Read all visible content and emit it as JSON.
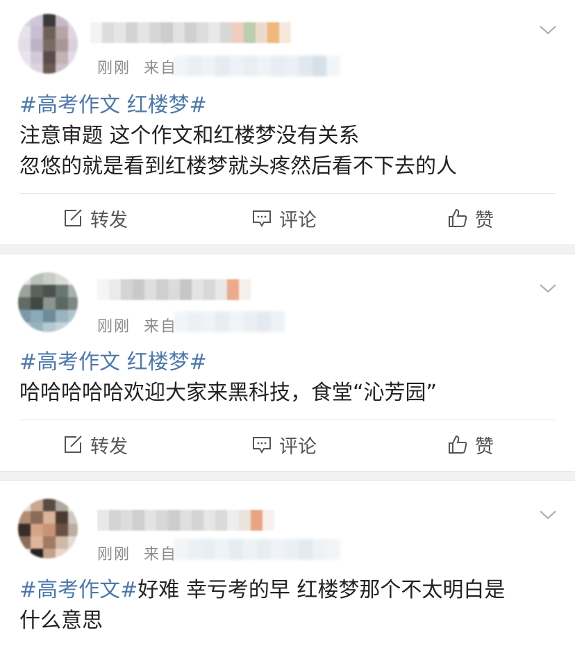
{
  "posts": [
    {
      "meta_time": "刚刚",
      "meta_from": "来自",
      "tag": "#高考作文 红楼梦#",
      "lines": [
        "注意审题 这个作文和红楼梦没有关系",
        "忽悠的就是看到红楼梦就头疼然后看不下去的人"
      ],
      "actions": {
        "repost": "转发",
        "comment": "评论",
        "like": "赞"
      }
    },
    {
      "meta_time": "刚刚",
      "meta_from": "来自",
      "tag": "#高考作文 红楼梦#",
      "lines": [
        "哈哈哈哈哈欢迎大家来黑科技，食堂“沁芳园”"
      ],
      "actions": {
        "repost": "转发",
        "comment": "评论",
        "like": "赞"
      }
    },
    {
      "meta_time": "刚刚",
      "meta_from": "来自",
      "tag": "#高考作文#",
      "text_after_tag": "好难 幸亏考的早 红楼梦那个不太明白是",
      "lines": [
        "什么意思"
      ]
    }
  ],
  "colors": {
    "tag": "#4d79a8",
    "meta": "#8a8a8a",
    "separator": "#f2f2f2"
  },
  "icons": {
    "repost": "edit-share-icon",
    "comment": "comment-bubble-icon",
    "like": "thumbs-up-icon",
    "more": "chevron-down-icon"
  }
}
